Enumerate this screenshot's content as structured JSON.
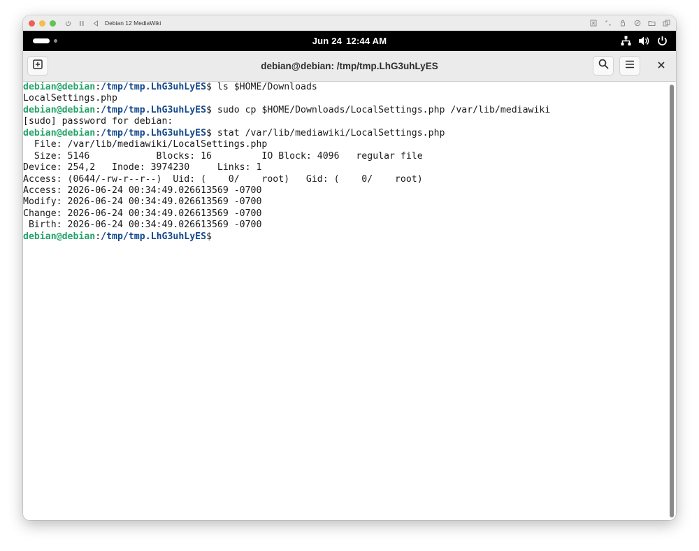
{
  "vm": {
    "title": "Debian 12 MediaWiki",
    "controls": [
      "power-icon",
      "pause-icon",
      "back-icon"
    ],
    "right_icons": [
      "screenshot-icon",
      "resize-icon",
      "lock-icon",
      "usb-icon",
      "folder-icon",
      "window-icon"
    ]
  },
  "gnome": {
    "date": "Jun 24",
    "time": "12:44 AM",
    "tray": [
      "network-icon",
      "volume-icon",
      "power-icon"
    ]
  },
  "terminal": {
    "title": "debian@debian: /tmp/tmp.LhG3uhLyES",
    "new_tab_icon": "new-tab-icon",
    "search_icon": "search-icon",
    "menu_icon": "hamburger-menu-icon",
    "close_label": "×",
    "colors": {
      "prompt_user": "#26a269",
      "prompt_path": "#12488b"
    },
    "lines": [
      {
        "type": "prompt",
        "user": "debian@debian",
        "sep": ":",
        "path": "/tmp/tmp.LhG3uhLyES",
        "suffix": "$ ",
        "cmd": "ls $HOME/Downloads"
      },
      {
        "type": "output",
        "text": "LocalSettings.php"
      },
      {
        "type": "prompt",
        "user": "debian@debian",
        "sep": ":",
        "path": "/tmp/tmp.LhG3uhLyES",
        "suffix": "$ ",
        "cmd": "sudo cp $HOME/Downloads/LocalSettings.php /var/lib/mediawiki"
      },
      {
        "type": "output",
        "text": "[sudo] password for debian:"
      },
      {
        "type": "prompt",
        "user": "debian@debian",
        "sep": ":",
        "path": "/tmp/tmp.LhG3uhLyES",
        "suffix": "$ ",
        "cmd": "stat /var/lib/mediawiki/LocalSettings.php"
      },
      {
        "type": "output",
        "text": "  File: /var/lib/mediawiki/LocalSettings.php"
      },
      {
        "type": "output",
        "text": "  Size: 5146            Blocks: 16         IO Block: 4096   regular file"
      },
      {
        "type": "output",
        "text": "Device: 254,2   Inode: 3974230     Links: 1"
      },
      {
        "type": "output",
        "text": "Access: (0644/-rw-r--r--)  Uid: (    0/    root)   Gid: (    0/    root)"
      },
      {
        "type": "output",
        "text": "Access: 2026-06-24 00:34:49.026613569 -0700"
      },
      {
        "type": "output",
        "text": "Modify: 2026-06-24 00:34:49.026613569 -0700"
      },
      {
        "type": "output",
        "text": "Change: 2026-06-24 00:34:49.026613569 -0700"
      },
      {
        "type": "output",
        "text": " Birth: 2026-06-24 00:34:49.026613569 -0700"
      },
      {
        "type": "prompt",
        "user": "debian@debian",
        "sep": ":",
        "path": "/tmp/tmp.LhG3uhLyES",
        "suffix": "$",
        "cmd": ""
      }
    ]
  }
}
